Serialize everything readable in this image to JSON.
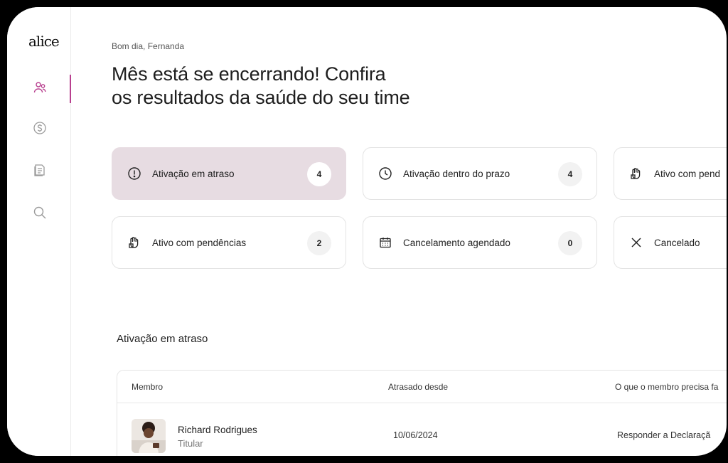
{
  "brand": {
    "logo": "alice"
  },
  "sidebar": {
    "items": [
      {
        "icon": "people-icon",
        "active": true
      },
      {
        "icon": "dollar-icon",
        "active": false
      },
      {
        "icon": "document-icon",
        "active": false
      },
      {
        "icon": "search-icon",
        "active": false
      }
    ]
  },
  "header": {
    "greeting": "Bom dia, Fernanda",
    "headline_line1": "Mês está se encerrando! Confira",
    "headline_line2": "os resultados da saúde do seu time"
  },
  "cards": [
    {
      "label": "Ativação em atraso",
      "count": "4",
      "icon": "alert-circle-icon",
      "active": true
    },
    {
      "label": "Ativação dentro do prazo",
      "count": "4",
      "icon": "clock-icon",
      "active": false
    },
    {
      "label": "Ativo com pend",
      "icon": "hand-icon",
      "active": false
    },
    {
      "label": "Ativo com pendências",
      "count": "2",
      "icon": "hand-icon",
      "active": false
    },
    {
      "label": "Cancelamento agendado",
      "count": "0",
      "icon": "calendar-icon",
      "active": false
    },
    {
      "label": "Cancelado",
      "icon": "close-icon",
      "active": false
    }
  ],
  "section": {
    "title": "Ativação em atraso"
  },
  "table": {
    "headers": [
      "Membro",
      "Atrasado desde",
      "O que o membro precisa fa"
    ],
    "rows": [
      {
        "name": "Richard Rodrigues",
        "role": "Titular",
        "date": "10/06/2024",
        "todo": "Responder a Declaraçã"
      }
    ]
  },
  "colors": {
    "accent": "#b8408f",
    "active_card": "#e7dce2",
    "border": "#e3e3e3"
  }
}
